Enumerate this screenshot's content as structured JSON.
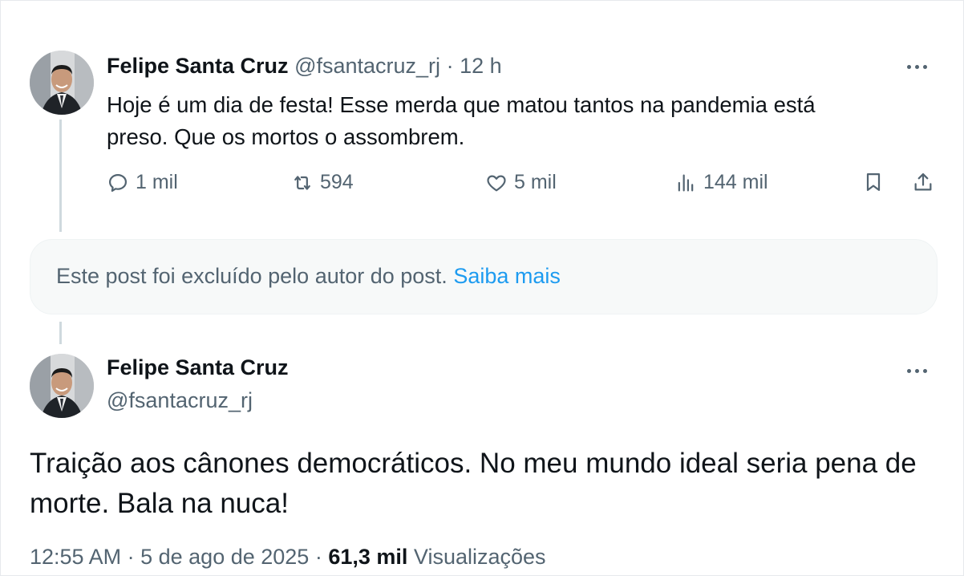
{
  "reply_tweet": {
    "author_name": "Felipe Santa Cruz",
    "author_handle": "@fsantacruz_rj",
    "separator": "·",
    "time_ago": "12 h",
    "text_line1": "Hoje é um dia de festa! Esse merda que matou tantos na pandemia está",
    "text_line2": "preso. Que os mortos o assombrem.",
    "metrics": {
      "replies": "1 mil",
      "retweets": "594",
      "likes": "5 mil",
      "views": "144 mil"
    }
  },
  "deleted_notice": {
    "text": "Este post foi excluído pelo autor do post.",
    "link": "Saiba mais"
  },
  "main_tweet": {
    "author_name": "Felipe Santa Cruz",
    "author_handle": "@fsantacruz_rj",
    "text_line1": "Traição aos cânones democráticos. No meu mundo ideal seria pena de",
    "text_line2": "morte. Bala na nuca!",
    "time": "12:55 AM",
    "separator": "·",
    "date": "5 de ago de 2025",
    "views_count": "61,3 mil",
    "views_label": "Visualizações"
  },
  "icons": [
    "avatar-photo",
    "more-icon",
    "reply-icon",
    "retweet-icon",
    "like-icon",
    "views-icon",
    "bookmark-icon",
    "share-icon"
  ],
  "colors": {
    "text_primary": "#0f1419",
    "text_secondary": "#536471",
    "link": "#1d9bf0",
    "notice_bg": "#f7f9f9",
    "thread_line": "#cfd9de"
  }
}
